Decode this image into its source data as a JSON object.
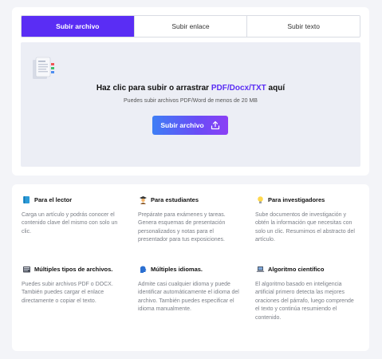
{
  "tabs": {
    "file": "Subir archivo",
    "link": "Subir enlace",
    "text": "Subir texto"
  },
  "dropzone": {
    "title_prefix": "Haz clic para subir o arrastrar ",
    "title_highlight": "PDF/Docx/TXT",
    "title_suffix": " aquí",
    "subtitle": "Puedes subir archivos PDF/Word de menos de 20 MB",
    "button_label": "Subir archivo"
  },
  "features": [
    {
      "icon": "book-icon",
      "title": "Para el lector",
      "desc": "Carga un artículo y podrás conocer el contenido clave del mismo con solo un clic."
    },
    {
      "icon": "student-icon",
      "title": "Para estudiantes",
      "desc": "Prepárate para exámenes y tareas. Genera esquemas de presentación personalizados y notas para el presentador para tus exposiciones."
    },
    {
      "icon": "lightbulb-icon",
      "title": "Para investigadores",
      "desc": "Sube documentos de investigación y obtén la información que necesitas con solo un clic. Resumimos el abstracto del artículo."
    },
    {
      "icon": "files-icon",
      "title": "Múltiples tipos de archivos.",
      "desc": "Puedes subir archivos PDF o DOCX. También puedes cargar el enlace directamente o copiar el texto."
    },
    {
      "icon": "speaking-head-icon",
      "title": "Múltiples idiomas.",
      "desc": "Admite casi cualquier idioma y puede identificar automáticamente el idioma del archivo. También puedes especificar el idioma manualmente."
    },
    {
      "icon": "laptop-icon",
      "title": "Algoritmo científico",
      "desc": "El algoritmo basado en inteligencia artificial primero detecta las mejores oraciones del párrafo, luego comprende el texto y continúa resumiendo el contenido."
    }
  ],
  "colors": {
    "accent": "#5a2df4",
    "button_gradient_start": "#3e7ef5",
    "button_gradient_end": "#8b3ff5"
  }
}
